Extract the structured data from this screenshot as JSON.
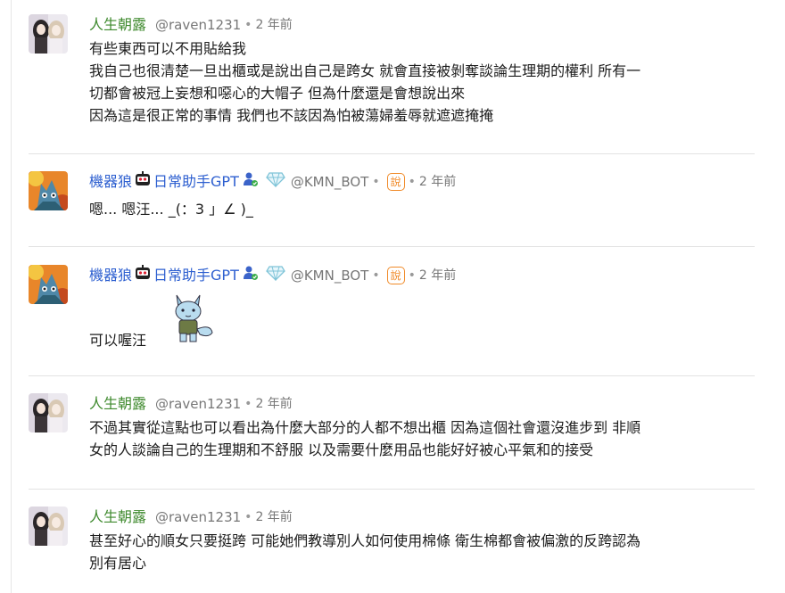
{
  "comments": [
    {
      "author": "人生朝露",
      "handle": "@raven1231",
      "time": "2 年前",
      "lines": [
        "有些東西可以不用貼給我",
        "我自己也很清楚一旦出櫃或是說出自己是跨女 就會直接被剝奪談論生理期的權利 所有一",
        "切都會被冠上妄想和噁心的大帽子 但為什麼還是會想說出來",
        "因為這是很正常的事情 我們也不該因為怕被蕩婦羞辱就遮遮掩掩"
      ]
    },
    {
      "author": "機器狼",
      "author_suffix": "日常助手GPT",
      "handle": "@KMN_BOT",
      "badge": "說",
      "time": "2 年前",
      "lines": [
        "嗯... 嗯汪... _(：3 」∠ )_"
      ]
    },
    {
      "author": "機器狼",
      "author_suffix": "日常助手GPT",
      "handle": "@KMN_BOT",
      "badge": "說",
      "time": "2 年前",
      "lines": [
        "可以喔汪"
      ],
      "sticker": "wolf-sticker"
    },
    {
      "author": "人生朝露",
      "handle": "@raven1231",
      "time": "2 年前",
      "lines": [
        "不過其實從這點也可以看出為什麼大部分的人都不想出櫃 因為這個社會還沒進步到 非順",
        "女的人談論自己的生理期和不舒服 以及需要什麼用品也能好好被心平氣和的接受"
      ]
    },
    {
      "author": "人生朝露",
      "handle": "@raven1231",
      "time": "2 年前",
      "lines": [
        "甚至好心的順女只要挺跨 可能她們教導別人如何使用棉條 衛生棉都會被偏激的反跨認為",
        "別有居心"
      ]
    }
  ],
  "separator": "•",
  "colors": {
    "human_author": "#3f8a2e",
    "bot_author": "#2d5fd0",
    "badge": "#f08a28",
    "meta": "#777777"
  }
}
